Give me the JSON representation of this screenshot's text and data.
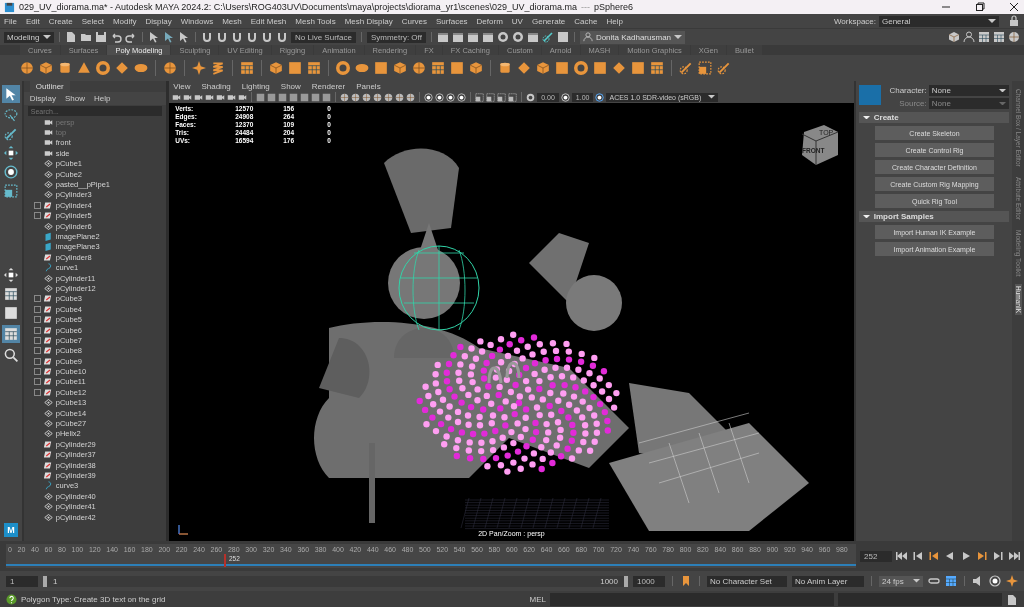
{
  "window": {
    "title": "029_UV_diorama.ma* - Autodesk MAYA 2024.2: C:\\Users\\ROG403UV\\Documents\\maya\\projects\\diorama_yr1\\scenes\\029_UV_diorama.ma",
    "separator": "---",
    "object": "pSphere6"
  },
  "menu": [
    "File",
    "Edit",
    "Create",
    "Select",
    "Modify",
    "Display",
    "Windows",
    "Mesh",
    "Edit Mesh",
    "Mesh Tools",
    "Mesh Display",
    "Curves",
    "Surfaces",
    "Deform",
    "UV",
    "Generate",
    "Cache",
    "Help"
  ],
  "workspace": {
    "label": "Workspace:",
    "value": "General"
  },
  "status_line": {
    "menu_set": "Modeling",
    "live_surface": "No Live Surface",
    "symmetry": "Symmetry: Off",
    "user": "Donita Kadharusman"
  },
  "shelf_tabs": [
    {
      "label": "Curves",
      "selected": false
    },
    {
      "label": "Surfaces",
      "selected": false
    },
    {
      "label": "Poly Modeling",
      "selected": true
    },
    {
      "label": "Sculpting",
      "selected": false
    },
    {
      "label": "UV Editing",
      "selected": false
    },
    {
      "label": "Rigging",
      "selected": false
    },
    {
      "label": "Animation",
      "selected": false
    },
    {
      "label": "Rendering",
      "selected": false
    },
    {
      "label": "FX",
      "selected": false
    },
    {
      "label": "FX Caching",
      "selected": false
    },
    {
      "label": "Custom",
      "selected": false
    },
    {
      "label": "Arnold",
      "selected": false
    },
    {
      "label": "MASH",
      "selected": false
    },
    {
      "label": "Motion Graphics",
      "selected": false
    },
    {
      "label": "XGen",
      "selected": false
    },
    {
      "label": "Bullet",
      "selected": false
    }
  ],
  "outliner": {
    "tab": "Outliner",
    "menu": [
      "Display",
      "Show",
      "Help"
    ],
    "search": {
      "placeholder": "Search..."
    },
    "items": [
      {
        "label": "persp",
        "kind": "camera",
        "expandable": false,
        "dimmed": true
      },
      {
        "label": "top",
        "kind": "camera",
        "expandable": false,
        "dimmed": true
      },
      {
        "label": "front",
        "kind": "camera",
        "expandable": false,
        "dimmed": false
      },
      {
        "label": "side",
        "kind": "camera",
        "expandable": false,
        "dimmed": false
      },
      {
        "label": "pCube1",
        "kind": "mesh",
        "expandable": false,
        "dimmed": false
      },
      {
        "label": "pCube2",
        "kind": "mesh",
        "expandable": false,
        "dimmed": false
      },
      {
        "label": "pasted__pPipe1",
        "kind": "mesh",
        "expandable": false,
        "dimmed": false
      },
      {
        "label": "pCylinder3",
        "kind": "mesh",
        "expandable": false,
        "dimmed": false
      },
      {
        "label": "pCylinder4",
        "kind": "group",
        "expandable": true,
        "dimmed": false
      },
      {
        "label": "pCylinder5",
        "kind": "group",
        "expandable": true,
        "dimmed": false
      },
      {
        "label": "pCylinder6",
        "kind": "mesh",
        "expandable": false,
        "dimmed": false
      },
      {
        "label": "imagePlane2",
        "kind": "image",
        "expandable": false,
        "dimmed": false
      },
      {
        "label": "imagePlane3",
        "kind": "image",
        "expandable": false,
        "dimmed": false
      },
      {
        "label": "pCylinder8",
        "kind": "group",
        "expandable": false,
        "dimmed": false
      },
      {
        "label": "curve1",
        "kind": "curve",
        "expandable": false,
        "dimmed": false
      },
      {
        "label": "pCylinder11",
        "kind": "mesh",
        "expandable": false,
        "dimmed": false
      },
      {
        "label": "pCylinder12",
        "kind": "mesh",
        "expandable": false,
        "dimmed": false
      },
      {
        "label": "pCube3",
        "kind": "group",
        "expandable": true,
        "dimmed": false
      },
      {
        "label": "pCube4",
        "kind": "group",
        "expandable": true,
        "dimmed": false
      },
      {
        "label": "pCube5",
        "kind": "group",
        "expandable": true,
        "dimmed": false
      },
      {
        "label": "pCube6",
        "kind": "group",
        "expandable": true,
        "dimmed": false
      },
      {
        "label": "pCube7",
        "kind": "group",
        "expandable": true,
        "dimmed": false
      },
      {
        "label": "pCube8",
        "kind": "group",
        "expandable": true,
        "dimmed": false
      },
      {
        "label": "pCube9",
        "kind": "group",
        "expandable": true,
        "dimmed": false
      },
      {
        "label": "pCube10",
        "kind": "group",
        "expandable": true,
        "dimmed": false
      },
      {
        "label": "pCube11",
        "kind": "group",
        "expandable": true,
        "dimmed": false
      },
      {
        "label": "pCube12",
        "kind": "group",
        "expandable": true,
        "dimmed": false
      },
      {
        "label": "pCube13",
        "kind": "mesh",
        "expandable": false,
        "dimmed": false
      },
      {
        "label": "pCube14",
        "kind": "mesh",
        "expandable": false,
        "dimmed": false
      },
      {
        "label": "pCube27",
        "kind": "mesh",
        "expandable": false,
        "dimmed": false
      },
      {
        "label": "pHelix2",
        "kind": "mesh",
        "expandable": false,
        "dimmed": false
      },
      {
        "label": "pCylinder29",
        "kind": "group",
        "expandable": false,
        "dimmed": false
      },
      {
        "label": "pCylinder37",
        "kind": "group",
        "expandable": false,
        "dimmed": false
      },
      {
        "label": "pCylinder38",
        "kind": "group",
        "expandable": false,
        "dimmed": false
      },
      {
        "label": "pCylinder39",
        "kind": "group",
        "expandable": false,
        "dimmed": false
      },
      {
        "label": "curve3",
        "kind": "curve",
        "expandable": false,
        "dimmed": false
      },
      {
        "label": "pCylinder40",
        "kind": "mesh",
        "expandable": false,
        "dimmed": false
      },
      {
        "label": "pCylinder41",
        "kind": "mesh",
        "expandable": false,
        "dimmed": false
      },
      {
        "label": "pCylinder42",
        "kind": "mesh",
        "expandable": false,
        "dimmed": false
      }
    ]
  },
  "viewport": {
    "menu": [
      "View",
      "Shading",
      "Lighting",
      "Show",
      "Renderer",
      "Panels"
    ],
    "exposure": "0.00",
    "gamma": "1.00",
    "color_space": "ACES 1.0 SDR-video (sRGB)",
    "hud": [
      {
        "label": "Verts:",
        "values": [
          "12570",
          "156",
          "0"
        ]
      },
      {
        "label": "Edges:",
        "values": [
          "24908",
          "264",
          "0"
        ]
      },
      {
        "label": "Faces:",
        "values": [
          "12370",
          "109",
          "0"
        ]
      },
      {
        "label": "Tris:",
        "values": [
          "24484",
          "204",
          "0"
        ]
      },
      {
        "label": "UVs:",
        "values": [
          "16594",
          "176",
          "0"
        ]
      }
    ],
    "view_cube": {
      "top": "TOP",
      "front": "FRONT"
    },
    "camera_label": "2D Pan/Zoom : persp"
  },
  "humanik": {
    "character": {
      "label": "Character:",
      "value": "None"
    },
    "source": {
      "label": "Source:",
      "value": "None",
      "disabled": true
    },
    "sections": [
      {
        "title": "Create",
        "buttons": [
          "Create Skeleton",
          "Create Control Rig",
          "Create Character Definition",
          "Create Custom Rig Mapping",
          "Quick Rig Tool"
        ]
      },
      {
        "title": "Import Samples",
        "buttons": [
          "Import Human IK Example",
          "Import Animation Example"
        ]
      }
    ]
  },
  "side_tabs": [
    {
      "label": "Channel Box / Layer Editor",
      "selected": false
    },
    {
      "label": "Attribute Editor",
      "selected": false
    },
    {
      "label": "Modeling Toolkit",
      "selected": false
    },
    {
      "label": "HumanIK",
      "selected": true
    }
  ],
  "timeline": {
    "ticks": [
      "0",
      "20",
      "40",
      "60",
      "80",
      "100",
      "120",
      "140",
      "160",
      "180",
      "200",
      "220",
      "240",
      "260",
      "280",
      "300",
      "320",
      "340",
      "360",
      "380",
      "400",
      "420",
      "440",
      "460",
      "480",
      "500",
      "520",
      "540",
      "560",
      "580",
      "600",
      "620",
      "640",
      "660",
      "680",
      "700",
      "720",
      "740",
      "760",
      "780",
      "800",
      "820",
      "840",
      "860",
      "880",
      "900",
      "920",
      "940",
      "960",
      "980"
    ],
    "current": "252",
    "level": 0.257,
    "frame_field": "252"
  },
  "logo": "M",
  "range": {
    "level": 1,
    "start": "1",
    "inner_start": "1",
    "inner_end": "1000",
    "end": "1000",
    "character_set": "No Character Set",
    "anim_layer": "No Anim Layer",
    "fps": "24 fps"
  },
  "help_line": {
    "text": "Polygon Type: Create 3D text on the grid",
    "command_label": "MEL"
  }
}
